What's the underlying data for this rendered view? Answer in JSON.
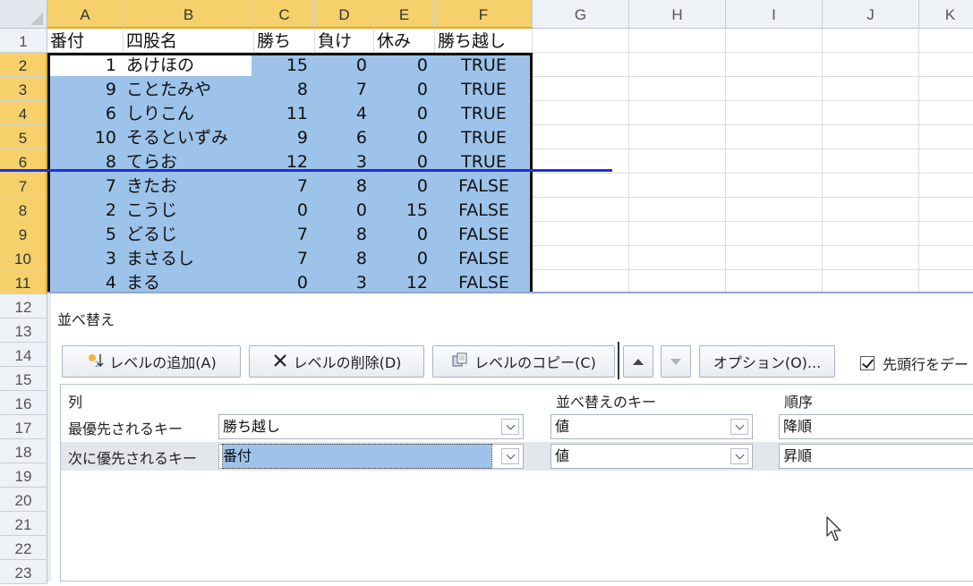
{
  "columns": [
    "A",
    "B",
    "C",
    "D",
    "E",
    "F",
    "G",
    "H",
    "I",
    "J",
    "K"
  ],
  "rows": [
    "1",
    "2",
    "3",
    "4",
    "5",
    "6",
    "7",
    "8",
    "9",
    "10",
    "11",
    "12",
    "13",
    "14",
    "15",
    "16",
    "17",
    "18",
    "19",
    "20",
    "21",
    "22",
    "23"
  ],
  "header_row": [
    "番付",
    "四股名",
    "勝ち",
    "負け",
    "休み",
    "勝ち越し"
  ],
  "data_rows": [
    {
      "rank": "1",
      "name": "あけほの",
      "wins": "15",
      "losses": "0",
      "absences": "0",
      "kachikoshi": "TRUE"
    },
    {
      "rank": "9",
      "name": "ことたみや",
      "wins": "8",
      "losses": "7",
      "absences": "0",
      "kachikoshi": "TRUE"
    },
    {
      "rank": "6",
      "name": "しりこん",
      "wins": "11",
      "losses": "4",
      "absences": "0",
      "kachikoshi": "TRUE"
    },
    {
      "rank": "10",
      "name": "そるといずみ",
      "wins": "9",
      "losses": "6",
      "absences": "0",
      "kachikoshi": "TRUE"
    },
    {
      "rank": "8",
      "name": "てらお",
      "wins": "12",
      "losses": "3",
      "absences": "0",
      "kachikoshi": "TRUE"
    },
    {
      "rank": "7",
      "name": "きたお",
      "wins": "7",
      "losses": "8",
      "absences": "0",
      "kachikoshi": "FALSE"
    },
    {
      "rank": "2",
      "name": "こうじ",
      "wins": "0",
      "losses": "0",
      "absences": "15",
      "kachikoshi": "FALSE"
    },
    {
      "rank": "5",
      "name": "どるじ",
      "wins": "7",
      "losses": "8",
      "absences": "0",
      "kachikoshi": "FALSE"
    },
    {
      "rank": "3",
      "name": "まさるし",
      "wins": "7",
      "losses": "8",
      "absences": "0",
      "kachikoshi": "FALSE"
    },
    {
      "rank": "4",
      "name": "まる",
      "wins": "0",
      "losses": "3",
      "absences": "12",
      "kachikoshi": "FALSE"
    }
  ],
  "dialog": {
    "title": "並べ替え",
    "buttons": {
      "add_level": "レベルの追加(A)",
      "delete_level": "レベルの削除(D)",
      "copy_level": "レベルのコピー(C)",
      "options": "オプション(O)..."
    },
    "header_checkbox_label": "先頭行をデー",
    "header_checkbox_checked": true,
    "col_headers": {
      "column": "列",
      "sort_on": "並べ替えのキー",
      "order": "順序"
    },
    "levels": [
      {
        "label": "最優先されるキー",
        "column": "勝ち越し",
        "sort_on": "値",
        "order": "降順",
        "selected": false
      },
      {
        "label": "次に優先されるキー",
        "column": "番付",
        "sort_on": "値",
        "order": "昇順",
        "selected": true
      }
    ]
  },
  "colors": {
    "selection": "#9dc3ea",
    "header_selected": "#f6d16b",
    "divider_line": "#1c2fe6"
  }
}
